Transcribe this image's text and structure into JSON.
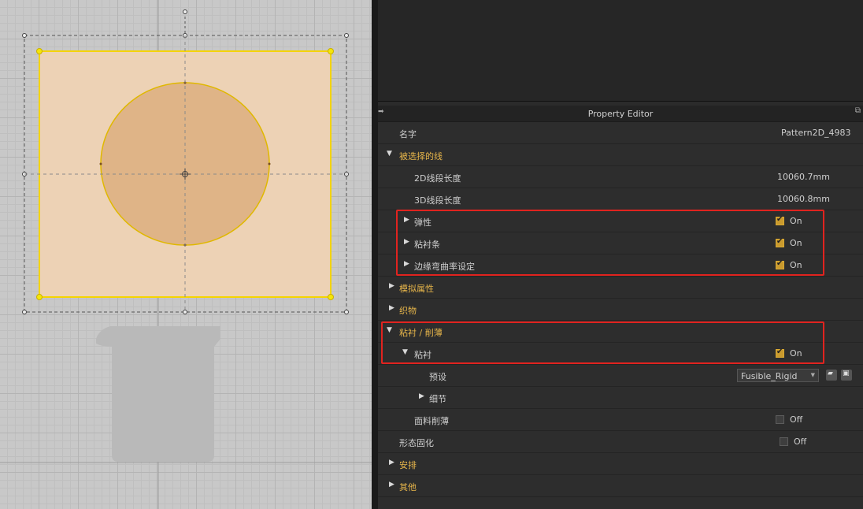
{
  "panel": {
    "title": "Property Editor",
    "pin_icon": "pin-arrow-icon",
    "popout_icon": "popout-icon"
  },
  "rows": {
    "name": {
      "label": "名字",
      "value": "Pattern2D_4983"
    },
    "selected_line": {
      "label": "被选择的线"
    },
    "len2d": {
      "label": "2D线段长度",
      "value": "10060.7mm"
    },
    "len3d": {
      "label": "3D线段长度",
      "value": "10060.8mm"
    },
    "elastic": {
      "label": "弹性",
      "state": "On"
    },
    "tape": {
      "label": "粘衬条",
      "state": "On"
    },
    "edge_curve": {
      "label": "边缘弯曲率设定",
      "state": "On"
    },
    "sim": {
      "label": "模拟属性"
    },
    "fabric": {
      "label": "织物"
    },
    "fuse_skive": {
      "label": "粘衬 / 削薄"
    },
    "fuse": {
      "label": "粘衬",
      "state": "On"
    },
    "preset": {
      "label": "预设",
      "value": "Fusible_Rigid"
    },
    "detail": {
      "label": "细节"
    },
    "skive": {
      "label": "面料削薄",
      "state": "Off"
    },
    "solidify": {
      "label": "形态固化",
      "state": "Off"
    },
    "arrange": {
      "label": "安排"
    },
    "other": {
      "label": "其他"
    }
  },
  "colors": {
    "accent": "#e6b54a",
    "highlight": "#e1231f",
    "pattern_fill": "#edd2b5",
    "circle_fill": "#dfb487",
    "selection": "#f5d400"
  }
}
